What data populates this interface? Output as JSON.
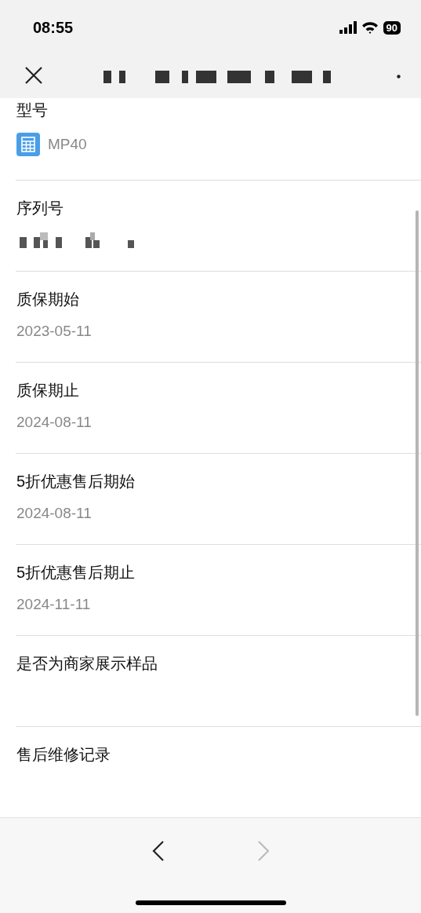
{
  "status_bar": {
    "time": "08:55",
    "battery": "90"
  },
  "fields": [
    {
      "kind": "model",
      "label": "型号",
      "value": "MP40"
    },
    {
      "kind": "redacted",
      "label": "序列号"
    },
    {
      "kind": "text",
      "label": "质保期始",
      "value": "2023-05-11"
    },
    {
      "kind": "text",
      "label": "质保期止",
      "value": "2024-08-11"
    },
    {
      "kind": "text",
      "label": "5折优惠售后期始",
      "value": "2024-08-11"
    },
    {
      "kind": "text",
      "label": "5折优惠售后期止",
      "value": "2024-11-11"
    },
    {
      "kind": "text",
      "label": "是否为商家展示样品"
    },
    {
      "kind": "text",
      "label": "售后维修记录"
    }
  ],
  "nav": {
    "back": {
      "disabled": false
    },
    "forward": {
      "disabled": true
    }
  }
}
